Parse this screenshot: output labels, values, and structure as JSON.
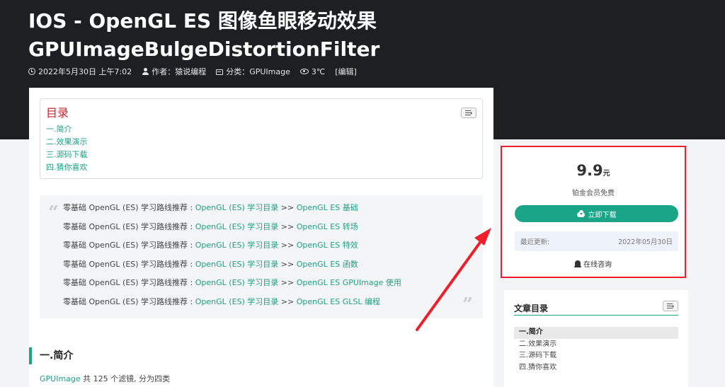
{
  "header": {
    "title_line1": "IOS  -  OpenGL ES 图像鱼眼移动效果",
    "title_line2": "GPUImageBulgeDistortionFilter",
    "meta": {
      "datetime": "2022年5月30日 上午7:02",
      "author": "作者：猿说编程",
      "category": "分类：GPUImage",
      "views": "3℃",
      "edit": "[编辑]"
    }
  },
  "toc": {
    "title": "目录",
    "items": [
      "一.简介",
      "二.效果演示",
      "三.源码下载",
      "四.猜你喜欢"
    ]
  },
  "quote": {
    "lines": [
      {
        "prefix": "零基础 OpenGL (ES) 学习路线推荐 : ",
        "link1": "OpenGL (ES) 学习目录",
        "sep": " >> ",
        "link2": "OpenGL ES 基础"
      },
      {
        "prefix": "零基础 OpenGL (ES) 学习路线推荐 : ",
        "link1": "OpenGL (ES) 学习目录",
        "sep": " >> ",
        "link2": "OpenGL ES 转场"
      },
      {
        "prefix": "零基础 OpenGL (ES) 学习路线推荐 : ",
        "link1": "OpenGL (ES) 学习目录",
        "sep": " >> ",
        "link2": "OpenGL ES 特效"
      },
      {
        "prefix": "零基础 OpenGL (ES) 学习路线推荐 : ",
        "link1": "OpenGL (ES) 学习目录",
        "sep": " >> ",
        "link2": "OpenGL ES 函数"
      },
      {
        "prefix": "零基础 OpenGL (ES) 学习路线推荐 : ",
        "link1": "OpenGL (ES) 学习目录",
        "sep": " >> ",
        "link2": "OpenGL ES GPUImage 使用"
      },
      {
        "prefix": "零基础 OpenGL (ES) 学习路线推荐 : ",
        "link1": "OpenGL (ES) 学习目录",
        "sep": " >> ",
        "link2": "OpenGL ES GLSL 编程"
      }
    ]
  },
  "section": {
    "heading": "一.简介",
    "intro_link": "GPUImage",
    "intro_text": " 共 125 个滤镜, 分为四类"
  },
  "price_card": {
    "price": "9.9",
    "unit": "元",
    "member_text": "铂金会员免费",
    "download_label": "立即下载",
    "update_label": "最近更新:",
    "update_date": "2022年05月30日",
    "consult_label": "在线咨询"
  },
  "side_toc": {
    "title": "文章目录",
    "items": [
      "一.简介",
      "二.效果演示",
      "三.源码下载",
      "四.猜你喜欢"
    ]
  },
  "colors": {
    "accent": "#1aa589",
    "link": "#1e9f87",
    "toc_title": "#c7252b",
    "highlight_border": "#ee1f2a",
    "header_bg": "#1d1f22"
  }
}
